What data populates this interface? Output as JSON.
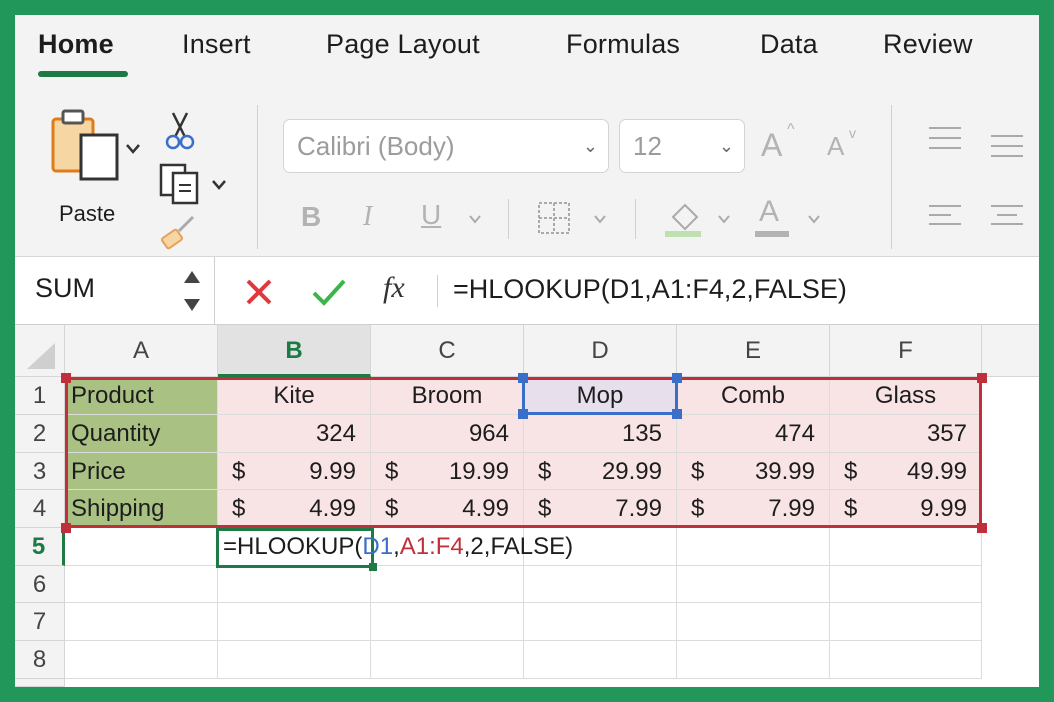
{
  "ribbon": {
    "tabs": [
      "Home",
      "Insert",
      "Page Layout",
      "Formulas",
      "Data",
      "Review"
    ],
    "active_tab": "Home",
    "paste_label": "Paste",
    "font_name": "Calibri (Body)",
    "font_size": "12",
    "bold": "B",
    "italic": "I",
    "underline": "U",
    "increase_font": "A",
    "decrease_font": "A",
    "font_color": "A",
    "accent_color": "#1d7a45"
  },
  "formula_bar": {
    "name_box": "SUM",
    "fx": "fx",
    "formula": "=HLOOKUP(D1,A1:F4,2,FALSE)"
  },
  "sheet": {
    "columns": [
      "A",
      "B",
      "C",
      "D",
      "E",
      "F"
    ],
    "rows": [
      "1",
      "2",
      "3",
      "4",
      "5",
      "6",
      "7",
      "8"
    ],
    "row1": {
      "a": "Product",
      "b": "Kite",
      "c": "Broom",
      "d": "Mop",
      "e": "Comb",
      "f": "Glass"
    },
    "row2": {
      "a": "Quantity",
      "b": "324",
      "c": "964",
      "d": "135",
      "e": "474",
      "f": "357"
    },
    "row3": {
      "a": "Price",
      "cur": "$",
      "b": "9.99",
      "c": "19.99",
      "d": "29.99",
      "e": "39.99",
      "f": "49.99"
    },
    "row4": {
      "a": "Shipping",
      "cur": "$",
      "b": "4.99",
      "c": "4.99",
      "d": "7.99",
      "e": "7.99",
      "f": "9.99"
    },
    "editing_cell": {
      "prefix": "=HLOOKUP(",
      "ref1": "D1",
      "comma1": ",",
      "ref2": "A1:F4",
      "suffix": ",2,FALSE)"
    },
    "colors": {
      "label_fill": "#a9c183",
      "range_fill": "#f9e4e5",
      "range_border": "#c0303a",
      "ref_blue": "#3a6fc9",
      "ref_red": "#c0303a"
    }
  }
}
